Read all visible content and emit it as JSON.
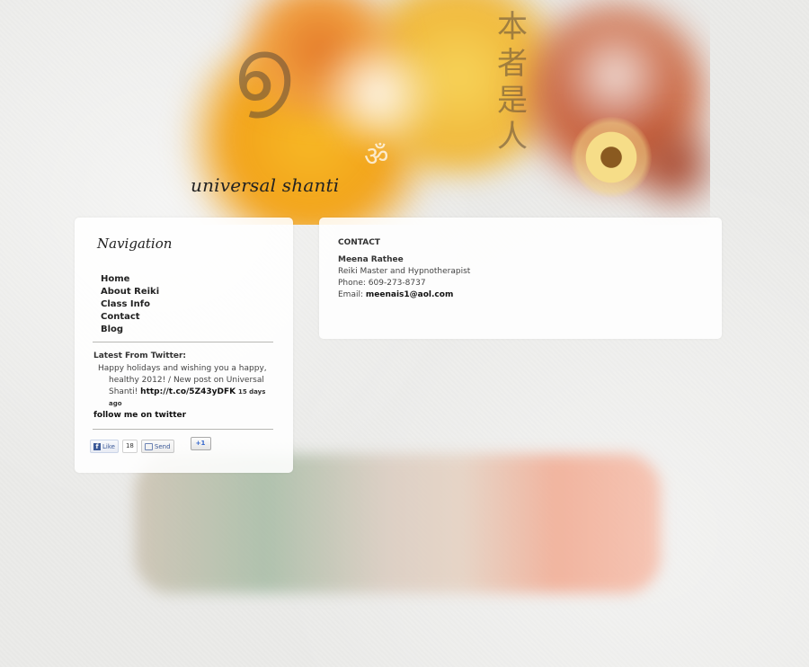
{
  "site": {
    "title": "universal shanti"
  },
  "navigation": {
    "heading": "Navigation",
    "items": [
      {
        "label": "Home"
      },
      {
        "label": "About Reiki"
      },
      {
        "label": "Class Info"
      },
      {
        "label": "Contact"
      },
      {
        "label": "Blog"
      }
    ]
  },
  "twitter": {
    "heading": "Latest From Twitter:",
    "tweet_text_1": "Happy holidays and wishing you a happy,",
    "tweet_text_2": "healthy 2012! / New post on Universal",
    "tweet_text_3": "Shanti!",
    "tweet_link": "http://t.co/5Z43yDFK",
    "tweet_time": "15 days",
    "tweet_time_2": "ago",
    "follow_label": "follow me on twitter"
  },
  "social": {
    "like_label": "Like",
    "like_count": "18",
    "send_label": "Send",
    "plus_one_label": "+1",
    "facebook_icon_glyph": "f"
  },
  "contact": {
    "heading": "CONTACT",
    "name": "Meena Rathee",
    "role": "Reiki Master and Hypnotherapist",
    "phone_label": "Phone:",
    "phone": "609-273-8737",
    "email_label": "Email:",
    "email": "meenais1@aol.com"
  },
  "icons": {
    "header_art": "watercolor-reiki-header-art",
    "facebook": "facebook-icon",
    "send": "send-icon",
    "google_plus": "google-plus-icon"
  }
}
